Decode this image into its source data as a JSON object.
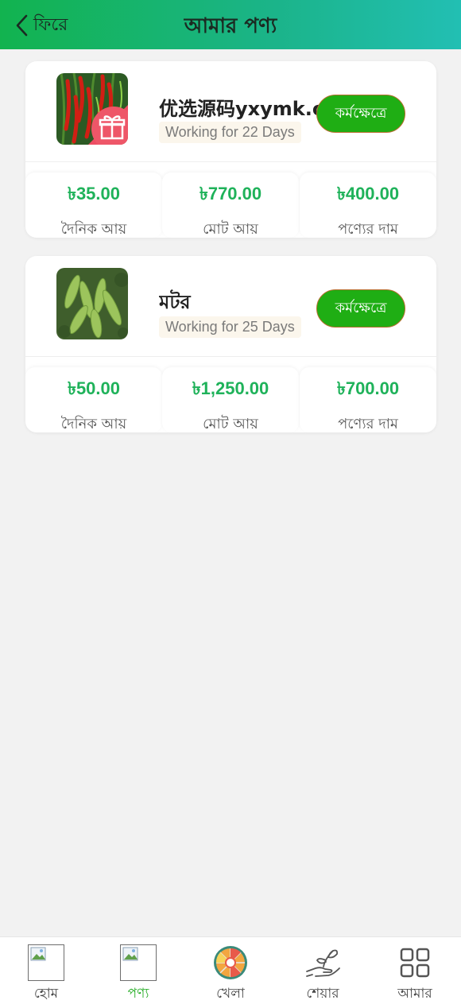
{
  "header": {
    "back_label": "ফিরে",
    "title": "আমার পণ্য"
  },
  "colors": {
    "accent_green": "#1fae14",
    "value_green": "#1fb25a",
    "header_start": "#12b34f",
    "header_end": "#22bfb3"
  },
  "products": [
    {
      "name": "优选源码yxymk.com",
      "working": "Working for 22 Days",
      "button": "কর্মক্ষেত্রে",
      "image_icon": "chili-pepper-image",
      "badge_icon": "gift-icon",
      "stats": [
        {
          "value": "৳35.00",
          "label": "দৈনিক আয়"
        },
        {
          "value": "৳770.00",
          "label": "মোট আয়"
        },
        {
          "value": "৳400.00",
          "label": "পণ্যের দাম"
        }
      ]
    },
    {
      "name": "মটর",
      "working": "Working for 25 Days",
      "button": "কর্মক্ষেত্রে",
      "image_icon": "pea-pods-image",
      "stats": [
        {
          "value": "৳50.00",
          "label": "দৈনিক আয়"
        },
        {
          "value": "৳1,250.00",
          "label": "মোট আয়"
        },
        {
          "value": "৳700.00",
          "label": "পণ্যের দাম"
        }
      ]
    }
  ],
  "tabbar": {
    "active": "পণ্য",
    "items": [
      {
        "label": "হোম",
        "icon": "broken-image-icon"
      },
      {
        "label": "পণ্য",
        "icon": "broken-image-icon"
      },
      {
        "label": "খেলা",
        "icon": "prize-wheel-icon"
      },
      {
        "label": "শেয়ার",
        "icon": "plant-hand-icon"
      },
      {
        "label": "আমার",
        "icon": "grid-icon"
      }
    ]
  }
}
